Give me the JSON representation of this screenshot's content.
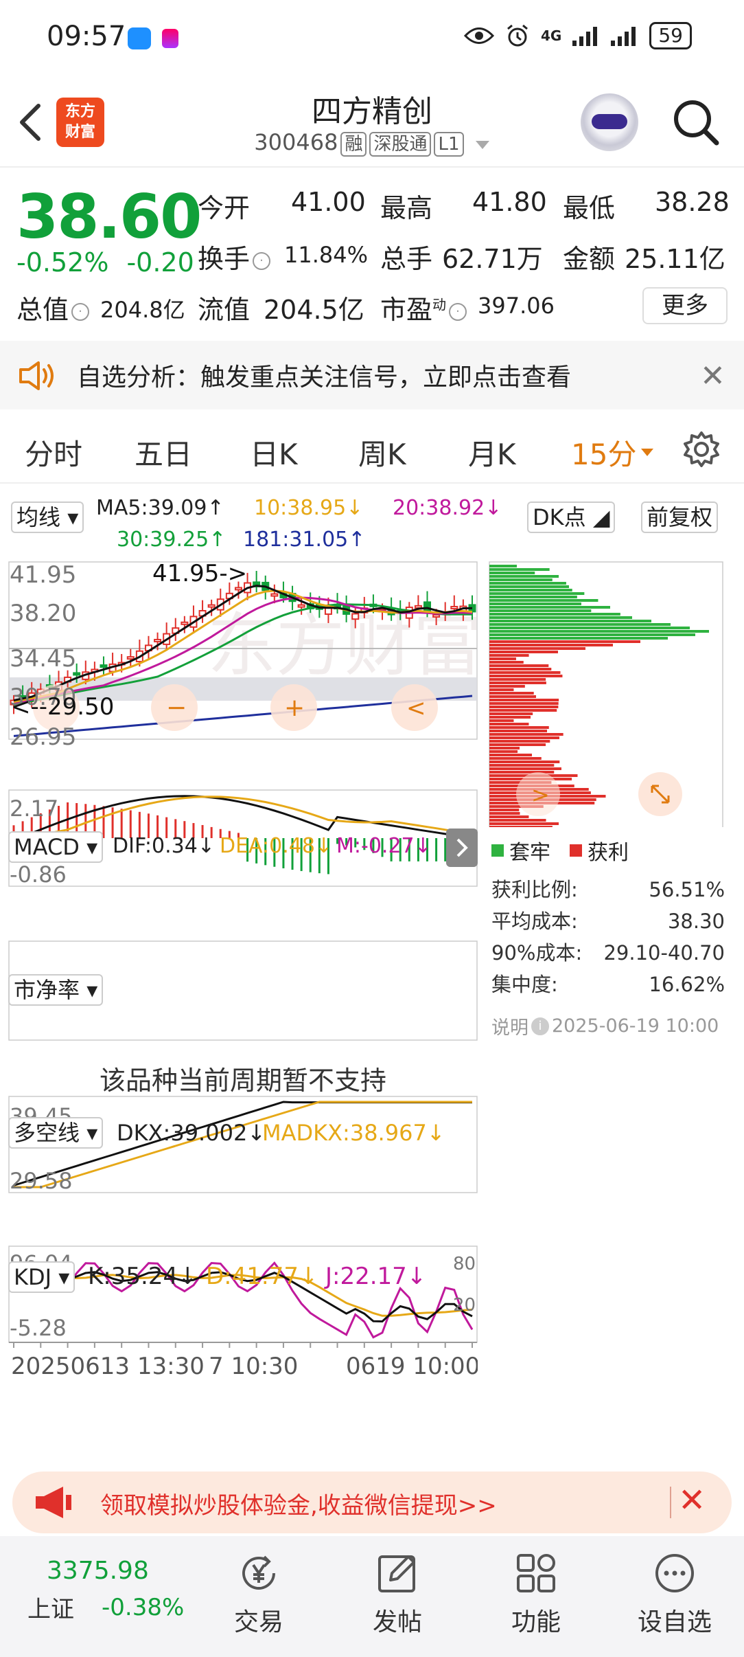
{
  "status_bar": {
    "time": "09:57",
    "network": "4G",
    "battery": "59"
  },
  "header": {
    "logo_line1": "东方",
    "logo_line2": "财富",
    "title": "四方精创",
    "code": "300468",
    "tags": [
      "融",
      "深股通",
      "L1"
    ]
  },
  "quote": {
    "price": "38.60",
    "change_pct": "-0.52%",
    "change_abs": "-0.20",
    "fields": {
      "open_label": "今开",
      "open": "41.00",
      "high_label": "最高",
      "high": "41.80",
      "low_label": "最低",
      "low": "38.28",
      "turnover_label": "换手",
      "turnover": "11.84%",
      "volume_label": "总手",
      "volume": "62.71万",
      "amount_label": "金额",
      "amount": "25.11亿",
      "mktcap_label": "总值",
      "mktcap": "204.8亿",
      "float_label": "流值",
      "float": "204.5亿",
      "pe_label": "市盈",
      "pe_sup": "动",
      "pe": "397.06"
    },
    "more_label": "更多"
  },
  "notice": {
    "text": "自选分析：触发重点关注信号，立即点击查看"
  },
  "tabs": [
    "分时",
    "五日",
    "日K",
    "周K",
    "月K",
    "15分"
  ],
  "active_tab": "15分",
  "main_chart": {
    "indicator_select": "均线",
    "ma5": "MA5:39.09↑",
    "ma10": "10:38.95↓",
    "ma20": "20:38.92↓",
    "ma30": "30:39.25↑",
    "ma181": "181:31.05↑",
    "y_ticks": [
      "41.95",
      "38.20",
      "34.45",
      "30.70",
      "26.95"
    ],
    "high_marker": "41.95->",
    "low_marker": "<--29.50",
    "colors": {
      "ma5": "#111111",
      "ma10": "#e6a817",
      "ma20": "#c0199c",
      "ma30": "#13a03a",
      "ma181": "#1f2f9c",
      "up": "#e0302b",
      "down": "#11a03a"
    }
  },
  "chip_panel": {
    "dk_select": "DK点",
    "rights_select": "前复权",
    "legend_trapped": "套牢",
    "legend_profit": "获利",
    "profit_ratio_label": "获利比例:",
    "profit_ratio": "56.51%",
    "avg_cost_label": "平均成本:",
    "avg_cost": "38.30",
    "cost90_label": "90%成本:",
    "cost90": "29.10-40.70",
    "concentration_label": "集中度:",
    "concentration": "16.62%",
    "note_label": "说明",
    "note_time": "2025-06-19 10:00"
  },
  "macd": {
    "select": "MACD",
    "dif": "DIF:0.34↓",
    "dea": "DEA:0.48↓",
    "m": "M:-0.27↓",
    "y_top": "2.17",
    "y_bottom": "-0.86"
  },
  "pb": {
    "select": "市净率",
    "message": "该品种当前周期暂不支持"
  },
  "dkx": {
    "select": "多空线",
    "dkx": "DKX:39.002↓",
    "madkx": "MADKX:38.967↓",
    "y_top": "39.45",
    "y_bottom": "29.58"
  },
  "kdj": {
    "select": "KDJ",
    "k": "K:35.24↓",
    "d": "D:41.77↓",
    "j": "J:22.17↓",
    "y_top": "96.04",
    "y_bottom": "-5.28",
    "ref80": "80",
    "ref20": "20"
  },
  "x_axis": {
    "left": "20250613 13:30",
    "mid": "7 10:30",
    "right": "0619 10:00"
  },
  "promo": {
    "text": "领取模拟炒股体验金,收益微信提现>>"
  },
  "bottom_nav": {
    "index_value": "3375.98",
    "index_name": "上证",
    "index_change": "-0.38%",
    "items": [
      "交易",
      "发帖",
      "功能",
      "设自选"
    ]
  }
}
